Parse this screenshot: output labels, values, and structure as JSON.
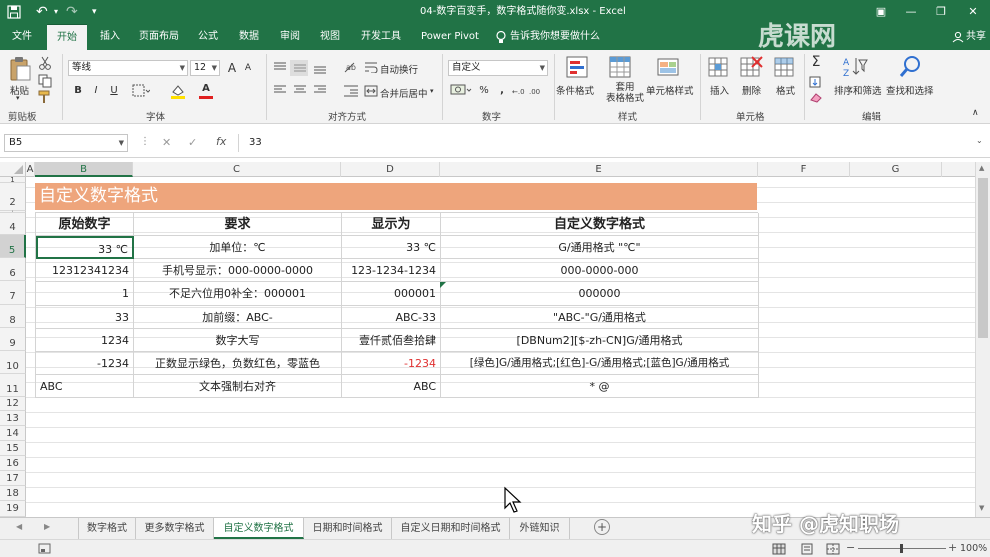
{
  "titlebar": {
    "title": "04-数字百变手，数字格式随你变.xlsx  -  Excel",
    "undo": "↶",
    "redo": "↷",
    "minimize": "—",
    "restore": "❐",
    "close": "✕",
    "ribbon_display": "▣"
  },
  "tabs": [
    "文件",
    "开始",
    "插入",
    "页面布局",
    "公式",
    "数据",
    "审阅",
    "视图",
    "开发工具",
    "Power Pivot"
  ],
  "tell_me": "告诉我你想要做什么",
  "share": "共享",
  "watermark_top": "虎课网",
  "ribbon": {
    "clipboard": {
      "paste": "粘贴",
      "group": "剪贴板"
    },
    "font": {
      "name": "等线",
      "size": "12",
      "bold": "B",
      "italic": "I",
      "underline": "U",
      "group": "字体",
      "grow": "A",
      "shrink": "A",
      "fill_color_letter": "A"
    },
    "alignment": {
      "wrap": "自动换行",
      "merge": "合并后居中",
      "group": "对齐方式"
    },
    "number": {
      "format": "自定义",
      "percent": "%",
      "comma": ",",
      "group": "数字"
    },
    "styles": {
      "conditional": "条件格式",
      "table": "套用\n表格格式",
      "cell_styles": "单元格样式",
      "group": "样式"
    },
    "cells": {
      "insert": "插入",
      "delete": "删除",
      "format": "格式",
      "group": "单元格"
    },
    "editing": {
      "sort": "排序和筛选",
      "find": "查找和选择",
      "group": "编辑"
    }
  },
  "formula_bar": {
    "name_box": "B5",
    "cancel": "✕",
    "enter": "✓",
    "fx": "fx",
    "value": "33"
  },
  "columns": [
    "A",
    "B",
    "C",
    "D",
    "E",
    "F",
    "G"
  ],
  "rows": [
    "1",
    "2",
    "3",
    "4",
    "5",
    "6",
    "7",
    "8",
    "9",
    "10",
    "11",
    "12",
    "13",
    "14",
    "15",
    "16",
    "17",
    "18",
    "19"
  ],
  "sheet": {
    "banner": "自定义数字格式",
    "headers": [
      "原始数字",
      "要求",
      "显示为",
      "自定义数字格式"
    ],
    "data": [
      [
        "33 ℃",
        "加单位：℃",
        "33 ℃",
        "G/通用格式 \"℃\""
      ],
      [
        "12312341234",
        "手机号显示：000-0000-0000",
        "123-1234-1234",
        "000-0000-000"
      ],
      [
        "1",
        "不足六位用0补全：000001",
        "000001",
        "000000"
      ],
      [
        "33",
        "加前缀：ABC-",
        "ABC-33",
        "\"ABC-\"G/通用格式"
      ],
      [
        "1234",
        "数字大写",
        "壹仟贰佰叁拾肆",
        "[DBNum2][$-zh-CN]G/通用格式"
      ],
      [
        "-1234",
        "正数显示绿色，负数红色，零蓝色",
        "-1234",
        "[绿色]G/通用格式;[红色]-G/通用格式;[蓝色]G/通用格式"
      ],
      [
        "ABC",
        "文本强制右对齐",
        "ABC",
        "* @"
      ]
    ]
  },
  "sheet_tabs": [
    "数字格式",
    "更多数字格式",
    "自定义数字格式",
    "日期和时间格式",
    "自定义日期和时间格式",
    "外链知识"
  ],
  "add_sheet": "+",
  "watermark_bottom": "知乎 @虎知职场",
  "status": {
    "zoom": "100%",
    "zoom_minus": "−",
    "zoom_plus": "+"
  },
  "colors": {
    "accent": "#217346",
    "banner": "#eea57c",
    "negative": "#e03030"
  }
}
